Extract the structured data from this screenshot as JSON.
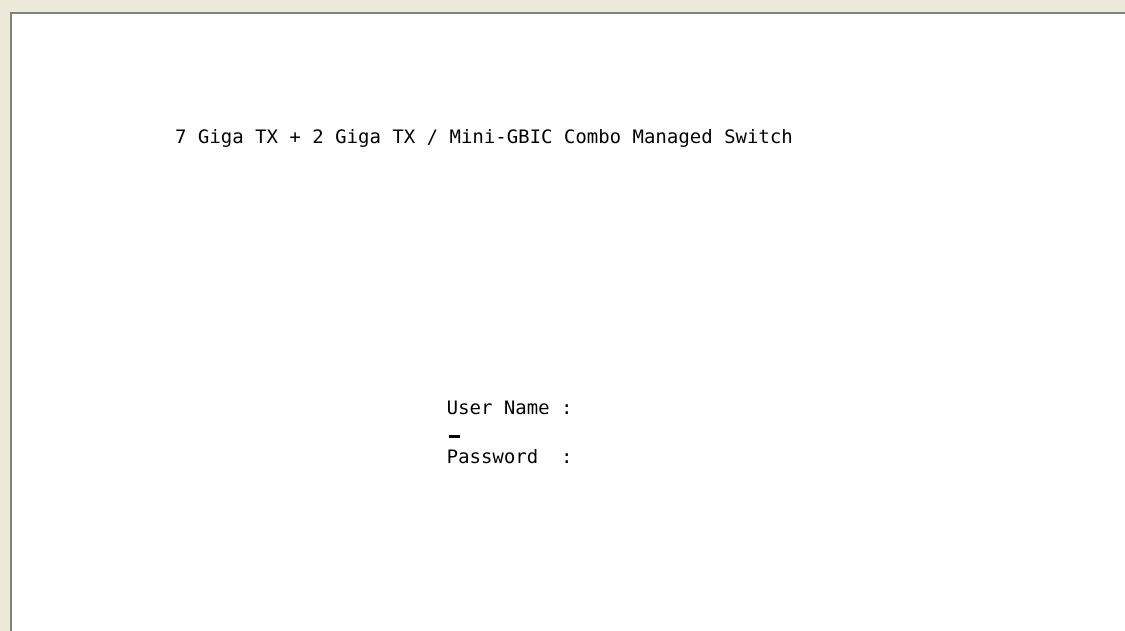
{
  "terminal": {
    "title": "7 Giga TX + 2 Giga TX / Mini-GBIC Combo Managed Switch"
  },
  "login": {
    "username_label": "User Name :",
    "username_value": "",
    "password_label": "Password  :",
    "password_value": ""
  },
  "colors": {
    "terminal_bg": "#ffffff",
    "text": "#000000",
    "window_bg": "#ece9d8"
  }
}
